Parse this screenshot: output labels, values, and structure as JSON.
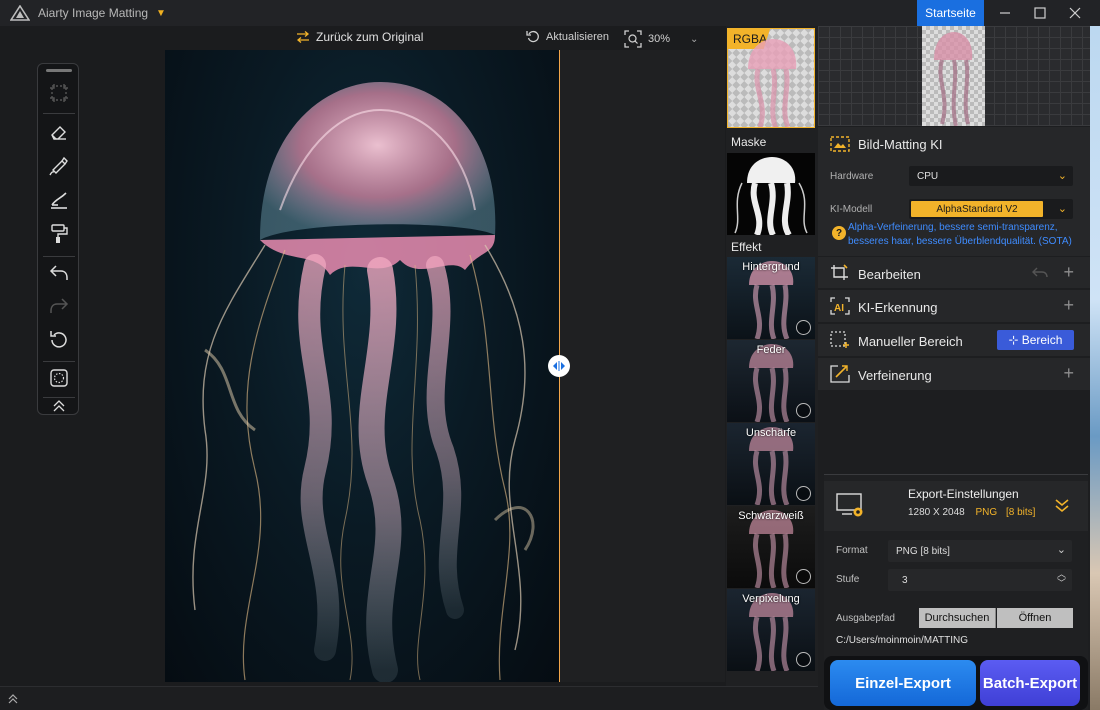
{
  "titlebar": {
    "app_title": "Aiarty Image Matting",
    "home_button": "Startseite"
  },
  "canvas_toolbar": {
    "back_to_original": "Zurück zum Original",
    "refresh": "Aktualisieren",
    "zoom": "30%"
  },
  "tools": [
    "crop-icon",
    "eraser-icon",
    "brush-icon",
    "sweep-icon",
    "paint-roller-icon",
    "undo-icon",
    "redo-icon",
    "reset-icon",
    "selection-icon",
    "collapse-up-icon"
  ],
  "effects": {
    "rgba_label": "RGBA",
    "mask_label": "Maske",
    "effect_label": "Effekt",
    "items": [
      {
        "label": "Hintergrund"
      },
      {
        "label": "Feder"
      },
      {
        "label": "Unschärfe"
      },
      {
        "label": "Schwarzweiß"
      },
      {
        "label": "Verpixelung"
      }
    ]
  },
  "panels": {
    "matting": {
      "title": "Bild-Matting KI",
      "hardware_label": "Hardware",
      "hardware_value": "CPU",
      "model_label": "KI-Modell",
      "model_value": "AlphaStandard  V2",
      "hint": "Alpha-Verfeinerung, bessere semi-transparenz, besseres haar, bessere Überblendqualität. (SOTA)"
    },
    "edit": {
      "title": "Bearbeiten"
    },
    "detection": {
      "title": "KI-Erkennung"
    },
    "manual": {
      "title": "Manueller Bereich",
      "button": "Bereich"
    },
    "refine": {
      "title": "Verfeinerung"
    }
  },
  "export": {
    "title": "Export-Einstellungen",
    "dims": "1280 X 2048",
    "format_badge": "PNG",
    "bits_badge": "[8 bits]",
    "format_label": "Format",
    "format_value": "PNG   [8 bits]",
    "level_label": "Stufe",
    "level_value": "3",
    "path_label": "Ausgabepfad",
    "browse": "Durchsuchen",
    "open": "Öffnen",
    "path_value": "C:/Users/moinmoin/MATTING",
    "single_export": "Einzel-Export",
    "batch_export": "Batch-Export"
  },
  "colors": {
    "accent": "#f2b32a",
    "blue": "#1a6fe0",
    "hint_blue": "#3f8cff",
    "split_line": "#f3a64a"
  }
}
